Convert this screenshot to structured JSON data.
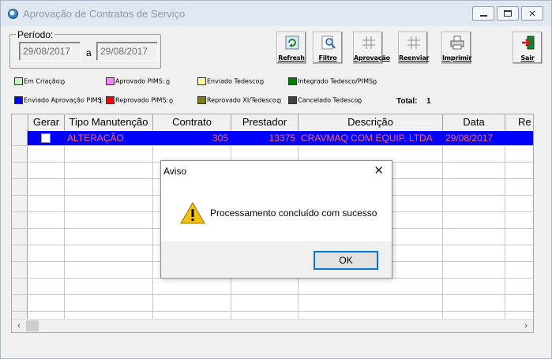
{
  "window": {
    "title": "Aprovação de Contratos de Serviço"
  },
  "period": {
    "label": "Período:",
    "from": "29/08/2017",
    "separator": "a",
    "to": "29/08/2017"
  },
  "toolbar": {
    "refresh": "Refresh",
    "filter": "Filtro",
    "approve": "Aprovação",
    "resend": "Reenviar",
    "print": "Imprimir",
    "exit": "Sair"
  },
  "legend": [
    {
      "label": "Em Criação:",
      "count": "0",
      "color": "#c8f2c8"
    },
    {
      "label": "Aprovado PIMS:",
      "count": "0",
      "color": "#ff80ff"
    },
    {
      "label": "Enviado Tedesco:",
      "count": "0",
      "color": "#ffffa0"
    },
    {
      "label": "Integrado Tedesco/PIMS:",
      "count": "0",
      "color": "#008000"
    },
    {
      "label": "Enviado Aprovação PIMS:",
      "count": "1",
      "color": "#0000ff"
    },
    {
      "label": "Reprovado PIMS:",
      "count": "0",
      "color": "#ff0000"
    },
    {
      "label": "Reprovado XI/Tedesco:",
      "count": "0",
      "color": "#808000"
    },
    {
      "label": "Cancelado Tedesco:",
      "count": "0",
      "color": "#404040"
    }
  ],
  "total": {
    "label": "Total:",
    "value": "1"
  },
  "grid": {
    "columns": [
      "Gerar",
      "Tipo Manutenção",
      "Contrato",
      "Prestador",
      "Descrição",
      "Data",
      "Re"
    ],
    "rows": [
      {
        "tipo": "ALTERAÇÃO",
        "contrato": "305",
        "prestador": "13375",
        "descricao": "CRAVMAQ COM EQUIP. LTDA",
        "data": "29/08/2017"
      }
    ]
  },
  "dialog": {
    "title": "Aviso",
    "message": "Processamento concluído com sucesso",
    "ok": "OK"
  },
  "colors": {
    "selection": "#0000ff",
    "selection_text": "#ff6666"
  }
}
